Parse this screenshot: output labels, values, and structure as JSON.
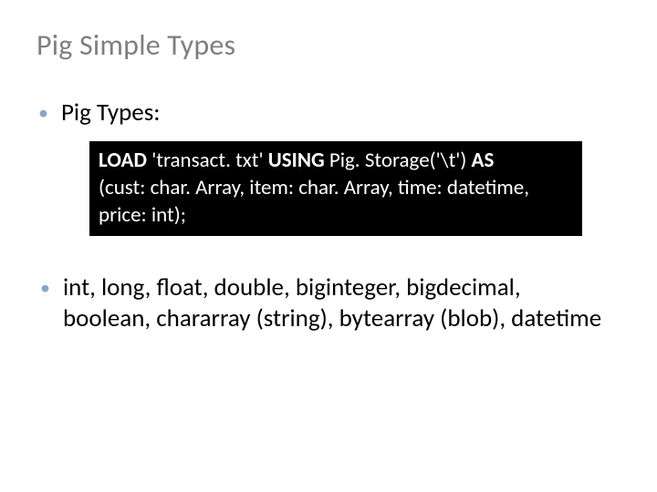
{
  "title": "Pig Simple Types",
  "bullet1": "Pig Types:",
  "code": {
    "w_load": "LOAD",
    "file": " 'transact. txt' ",
    "w_using": "USING",
    "storage": " Pig. Storage('\\t') ",
    "w_as": "AS",
    "line2": "(cust: char. Array, item: char. Array, time: datetime,",
    "line3": "price: int);"
  },
  "bullet2": "int, long, float, double, biginteger, bigdecimal, boolean, chararray (string), bytearray (blob), datetime"
}
